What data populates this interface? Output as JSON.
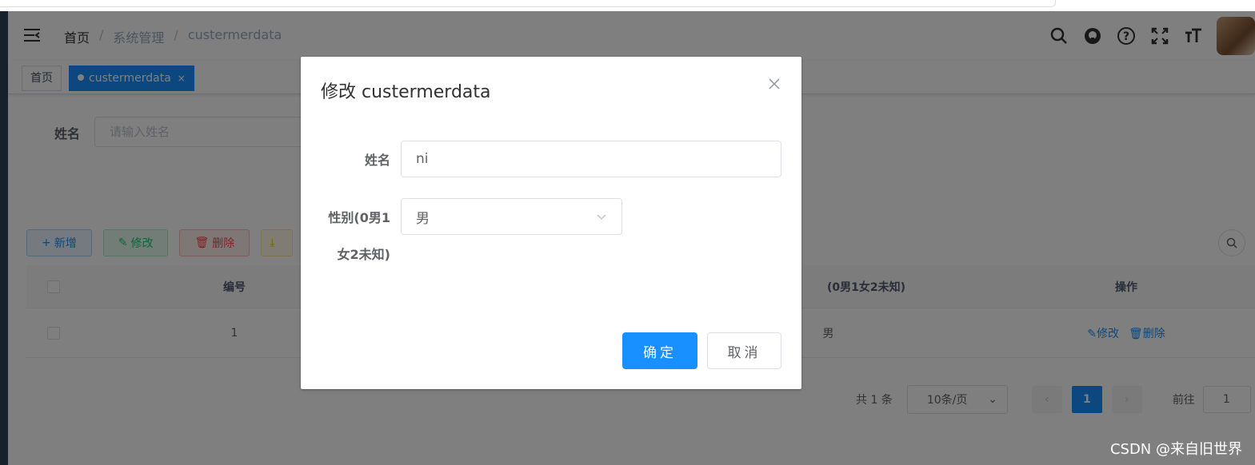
{
  "breadcrumb": [
    "首页",
    "系统管理",
    "custermerdata"
  ],
  "tags": {
    "home": "首页",
    "active": "custermerdata",
    "close": "×"
  },
  "search": {
    "label": "姓名",
    "placeholder": "请输入姓名"
  },
  "toolbar": {
    "add": "新增",
    "edit": "修改",
    "delete": "删除"
  },
  "table": {
    "headers": {
      "id": "编号",
      "gender": "(0男1女2未知)",
      "ops": "操作"
    },
    "rows": [
      {
        "id": "1",
        "gender": "男",
        "edit": "修改",
        "delete": "删除"
      }
    ]
  },
  "pagination": {
    "total": "共 1 条",
    "size": "10条/页",
    "page": "1",
    "jump_label": "前往",
    "jump_value": "1"
  },
  "dialog": {
    "title": "修改 custermerdata",
    "name_label": "姓名",
    "name_value": "ni",
    "gender_label_1": "性别(0男1",
    "gender_label_2": "女2未知)",
    "gender_value": "男",
    "ok": "确定",
    "cancel": "取消"
  },
  "watermark": "CSDN @来自旧世界",
  "colors": {
    "primary": "#1890ff",
    "success": "#13ce66",
    "danger": "#ff4949",
    "warning": "#ffba00",
    "sidebar": "#304156"
  }
}
